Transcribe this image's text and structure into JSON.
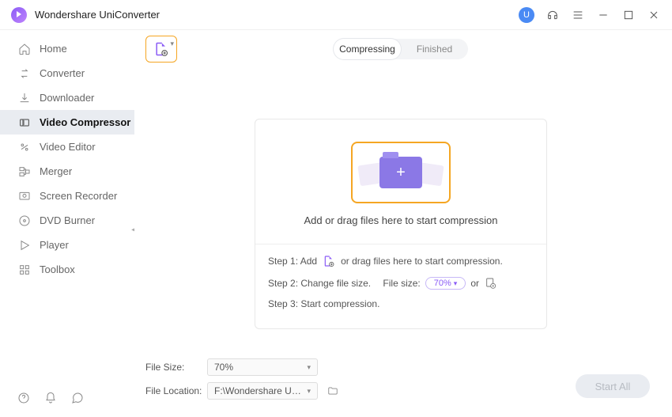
{
  "app": {
    "title": "Wondershare UniConverter"
  },
  "titlebar": {
    "avatar_initial": "U"
  },
  "sidebar": {
    "items": [
      {
        "label": "Home",
        "name": "sidebar-item-home"
      },
      {
        "label": "Converter",
        "name": "sidebar-item-converter"
      },
      {
        "label": "Downloader",
        "name": "sidebar-item-downloader"
      },
      {
        "label": "Video Compressor",
        "name": "sidebar-item-video-compressor"
      },
      {
        "label": "Video Editor",
        "name": "sidebar-item-video-editor"
      },
      {
        "label": "Merger",
        "name": "sidebar-item-merger"
      },
      {
        "label": "Screen Recorder",
        "name": "sidebar-item-screen-recorder"
      },
      {
        "label": "DVD Burner",
        "name": "sidebar-item-dvd-burner"
      },
      {
        "label": "Player",
        "name": "sidebar-item-player"
      },
      {
        "label": "Toolbox",
        "name": "sidebar-item-toolbox"
      }
    ],
    "active_index": 3
  },
  "tabs": {
    "compressing": "Compressing",
    "finished": "Finished",
    "active": "compressing"
  },
  "dropzone": {
    "main_text": "Add or drag files here to start compression",
    "step1_prefix": "Step 1: Add",
    "step1_suffix": "or drag files here to start compression.",
    "step2_prefix": "Step 2: Change file size.",
    "step2_filesize_label": "File size:",
    "step2_pill_value": "70%",
    "step2_or": "or",
    "step3": "Step 3: Start compression."
  },
  "footer": {
    "filesize_label": "File Size:",
    "filesize_value": "70%",
    "location_label": "File Location:",
    "location_value": "F:\\Wondershare UniConverte",
    "start_label": "Start All"
  }
}
